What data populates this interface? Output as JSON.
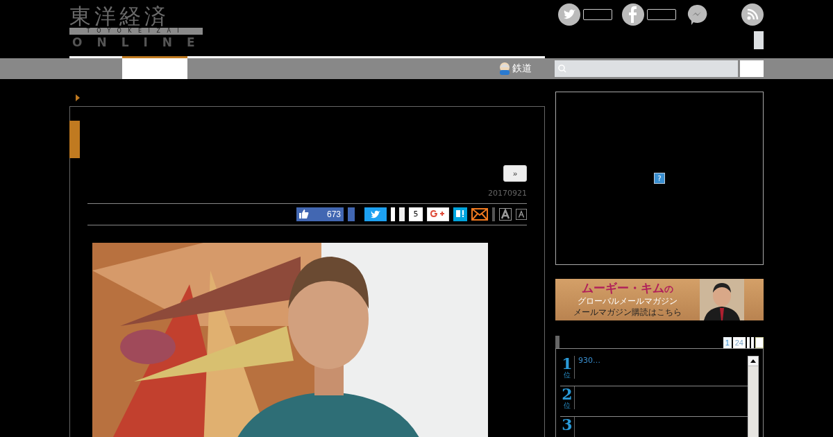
{
  "logo": {
    "kanji": "東洋経済",
    "romaji": "TOYOKEIZAI",
    "online": "ONLINE"
  },
  "nav": {
    "tabs": [
      {
        "selected": false
      },
      {
        "selected": true
      }
    ],
    "channel": "鉄道"
  },
  "article": {
    "next_button": "»",
    "date": "20170921",
    "like_count": "673",
    "share_count": "5"
  },
  "ad": {
    "help": "?"
  },
  "banner": {
    "title": "ムーギー・キム",
    "title_suffix": "の",
    "subtitle": "グローバルメールマガジン",
    "cta": "メールマガジン購読はこちら"
  },
  "ranking": {
    "tabs": [
      {
        "label": "1",
        "selected": true
      },
      {
        "label": "24",
        "selected": false
      }
    ],
    "items": [
      {
        "rank": "1",
        "unit": "位",
        "title": "930…"
      },
      {
        "rank": "2",
        "unit": "位"
      },
      {
        "rank": "3"
      }
    ]
  }
}
